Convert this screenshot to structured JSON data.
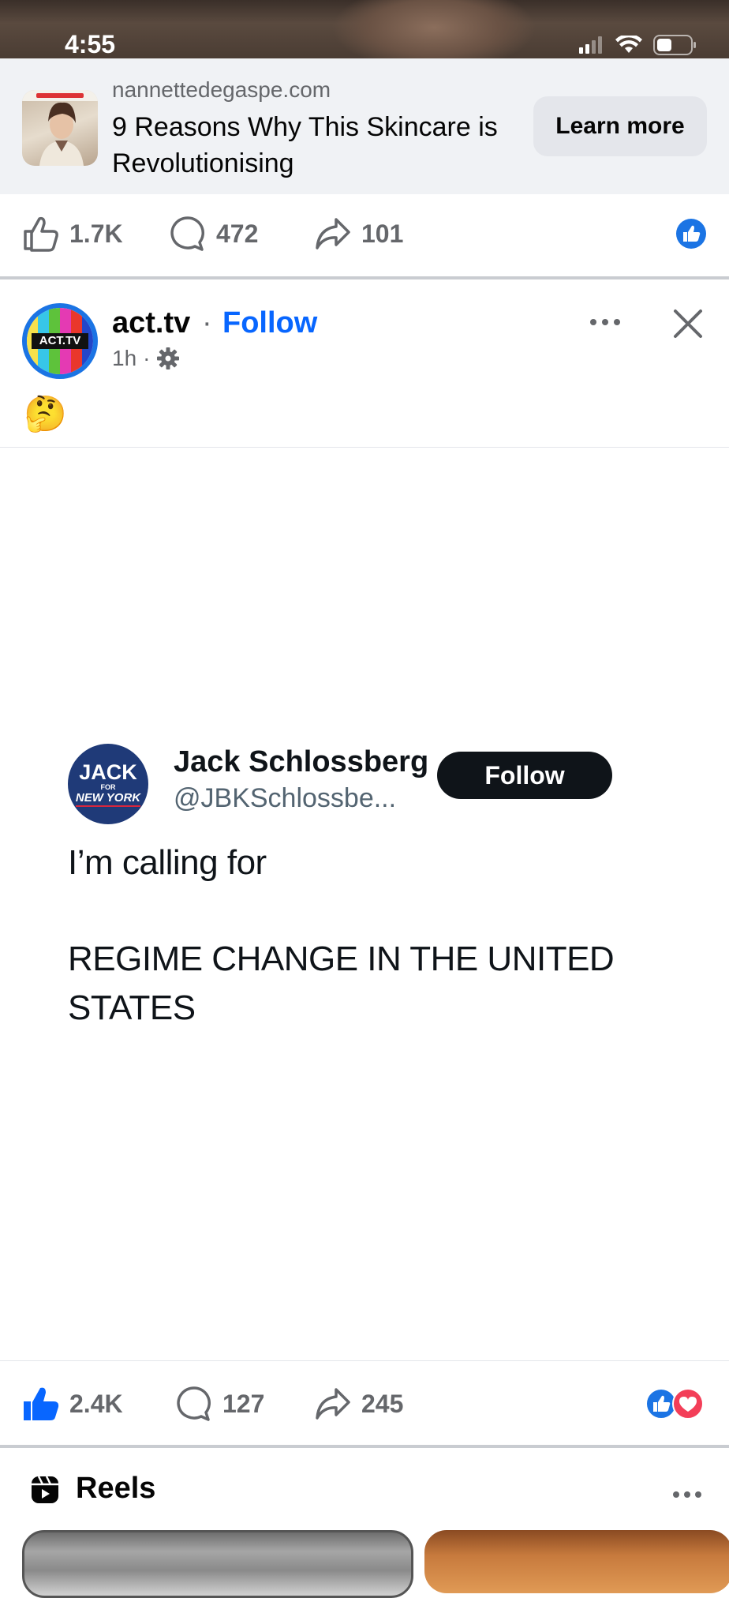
{
  "status_bar": {
    "time": "4:55"
  },
  "ad": {
    "domain": "nannettedegaspe.com",
    "title": "9 Reasons Why This Skincare is Revolutionising",
    "cta_label": "Learn more"
  },
  "ad_actions": {
    "likes": "1.7K",
    "comments": "472",
    "shares": "101"
  },
  "post": {
    "page_name": "act.tv",
    "separator": "·",
    "follow_label": "Follow",
    "time_ago": "1h",
    "time_separator": "·",
    "emoji": "🤔",
    "avatar_text": "ACT.TV",
    "embedded_tweet": {
      "avatar_line1": "JACK",
      "avatar_line2": "FOR",
      "avatar_line3": "NEW YORK",
      "author_name": "Jack Schlossberg",
      "author_handle": "@JBKSchlossbe...",
      "follow_label": "Follow",
      "text_line1": "I’m calling for",
      "text_line2": "REGIME CHANGE IN THE UNITED",
      "text_line3": "STATES"
    },
    "actions": {
      "likes": "2.4K",
      "comments": "127",
      "shares": "245"
    }
  },
  "reels": {
    "title": "Reels"
  },
  "colors": {
    "fb_blue": "#0866ff",
    "reaction_like": "#1b74e4",
    "reaction_love": "#f33e58"
  }
}
